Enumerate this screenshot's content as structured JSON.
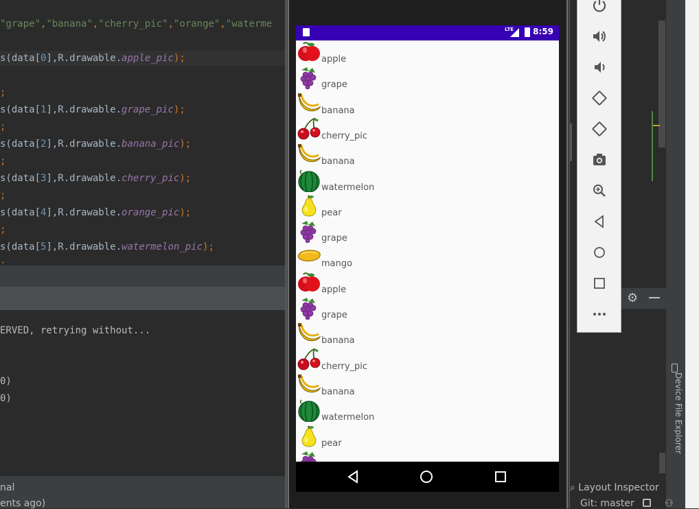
{
  "editor": {
    "lines": [
      {
        "parts": [
          {
            "t": "\"grape\"",
            "c": "str"
          },
          {
            "t": ",",
            "c": "kw"
          },
          {
            "t": "\"banana\"",
            "c": "str"
          },
          {
            "t": ",",
            "c": "kw"
          },
          {
            "t": "\"cherry_pic\"",
            "c": "str"
          },
          {
            "t": ",",
            "c": "kw"
          },
          {
            "t": "\"orange\"",
            "c": "str"
          },
          {
            "t": ",",
            "c": "kw"
          },
          {
            "t": "\"waterme",
            "c": "str"
          }
        ]
      },
      {
        "parts": [
          {
            "t": "s(data[",
            "c": ""
          },
          {
            "t": "0",
            "c": "num"
          },
          {
            "t": "],R.drawable.",
            "c": ""
          },
          {
            "t": "apple_pic",
            "c": "fld"
          },
          {
            "t": ");",
            "c": "kw"
          }
        ]
      },
      {
        "parts": [
          {
            "t": ";",
            "c": "kw"
          }
        ]
      },
      {
        "parts": [
          {
            "t": "s(data[",
            "c": ""
          },
          {
            "t": "1",
            "c": "num"
          },
          {
            "t": "],R.drawable.",
            "c": ""
          },
          {
            "t": "grape_pic",
            "c": "fld"
          },
          {
            "t": ");",
            "c": "kw"
          }
        ]
      },
      {
        "parts": [
          {
            "t": ";",
            "c": "kw"
          }
        ]
      },
      {
        "parts": [
          {
            "t": "s(data[",
            "c": ""
          },
          {
            "t": "2",
            "c": "num"
          },
          {
            "t": "],R.drawable.",
            "c": ""
          },
          {
            "t": "banana_pic",
            "c": "fld"
          },
          {
            "t": ");",
            "c": "kw"
          }
        ]
      },
      {
        "parts": [
          {
            "t": ";",
            "c": "kw"
          }
        ]
      },
      {
        "parts": [
          {
            "t": "s(data[",
            "c": ""
          },
          {
            "t": "3",
            "c": "num"
          },
          {
            "t": "],R.drawable.",
            "c": ""
          },
          {
            "t": "cherry_pic",
            "c": "fld"
          },
          {
            "t": ");",
            "c": "kw"
          }
        ]
      },
      {
        "parts": [
          {
            "t": ";",
            "c": "kw"
          }
        ]
      },
      {
        "parts": [
          {
            "t": "s(data[",
            "c": ""
          },
          {
            "t": "4",
            "c": "num"
          },
          {
            "t": "],R.drawable.",
            "c": ""
          },
          {
            "t": "orange_pic",
            "c": "fld"
          },
          {
            "t": ");",
            "c": "kw"
          }
        ]
      },
      {
        "parts": [
          {
            "t": ";",
            "c": "kw"
          }
        ]
      },
      {
        "parts": [
          {
            "t": "s(data[",
            "c": ""
          },
          {
            "t": "5",
            "c": "num"
          },
          {
            "t": "],R.drawable.",
            "c": ""
          },
          {
            "t": "watermelon_pic",
            "c": "fld"
          },
          {
            "t": ");",
            "c": "kw"
          }
        ]
      }
    ]
  },
  "console": {
    "lines": [
      "ERVED, retrying without...",
      "",
      "",
      "0)",
      "0)"
    ]
  },
  "bottom_bar": {
    "tab_label": "nal",
    "status": "ents ago)"
  },
  "phone": {
    "status_time": "8:59",
    "status_network": "LTE",
    "list": [
      {
        "label": "apple",
        "icon": "apple-icon"
      },
      {
        "label": "grape",
        "icon": "grape-icon"
      },
      {
        "label": "banana",
        "icon": "banana-icon"
      },
      {
        "label": "cherry_pic",
        "icon": "cherry-icon"
      },
      {
        "label": "banana",
        "icon": "banana-icon"
      },
      {
        "label": "watermelon",
        "icon": "watermelon-icon"
      },
      {
        "label": "pear",
        "icon": "pear-icon"
      },
      {
        "label": "grape",
        "icon": "grape-icon"
      },
      {
        "label": "mango",
        "icon": "mango-icon"
      },
      {
        "label": "apple",
        "icon": "apple-icon"
      },
      {
        "label": "grape",
        "icon": "grape-icon"
      },
      {
        "label": "banana",
        "icon": "banana-icon"
      },
      {
        "label": "cherry_pic",
        "icon": "cherry-icon"
      },
      {
        "label": "banana",
        "icon": "banana-icon"
      },
      {
        "label": "watermelon",
        "icon": "watermelon-icon"
      },
      {
        "label": "pear",
        "icon": "pear-icon"
      },
      {
        "label": "",
        "icon": "grape-icon"
      }
    ]
  },
  "emulator_tools": [
    "power-icon",
    "volume-up-icon",
    "volume-down-icon",
    "rotate-left-icon",
    "rotate-right-icon",
    "camera-icon",
    "zoom-icon",
    "back-icon",
    "home-icon",
    "overview-icon",
    "more-icon"
  ],
  "right_panel": {
    "layout_inspector": "Layout Inspector",
    "git_branch": "Git: master",
    "device_file_explorer": "Device File Explorer"
  },
  "colors": {
    "status_bar": "#3700b3",
    "editor_bg": "#2b2b2b",
    "panel_bg": "#3c3f41"
  }
}
